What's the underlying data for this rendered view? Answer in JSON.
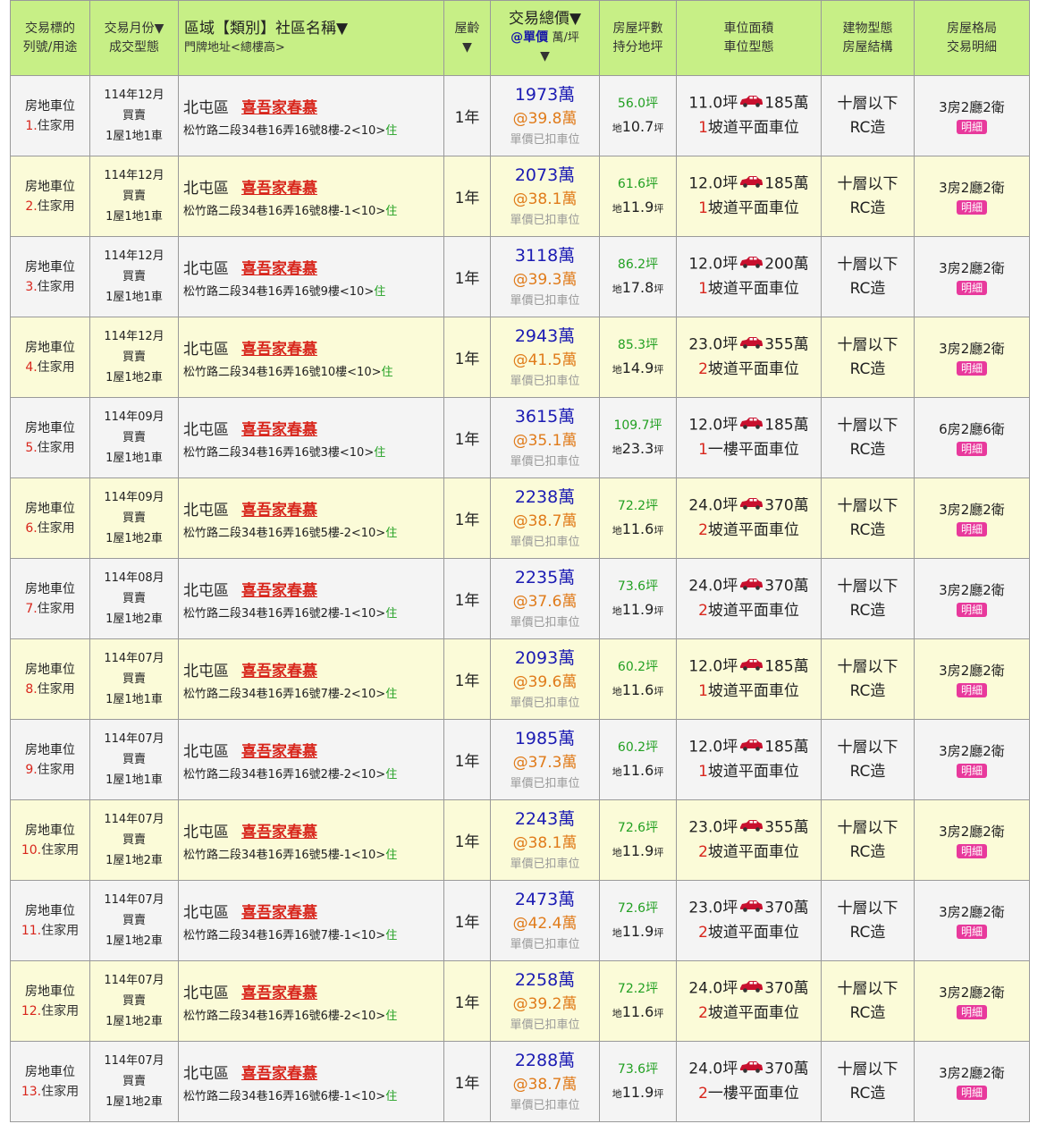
{
  "header": {
    "col1": [
      "交易標的",
      "列號/用途"
    ],
    "col2": [
      "交易月份▼",
      "成交型態"
    ],
    "col3_main": "區域【類別】社區名稱▼",
    "col3_sub": "門牌地址<總樓高>",
    "col4": [
      "屋齡",
      "▼"
    ],
    "col5_line1": "交易總價▼",
    "col5_unit_label": "@單價",
    "col5_unit_suffix": "萬/坪",
    "col5_arrow": "▼",
    "col6": [
      "房屋坪數",
      "持分地坪"
    ],
    "col7": [
      "車位面積",
      "車位型態"
    ],
    "col8": [
      "建物型態",
      "房屋結構"
    ],
    "col9": [
      "房屋格局",
      "交易明細"
    ]
  },
  "colors": {
    "header_bg": "#c7ef86",
    "row_odd": "#f4f4f4",
    "row_even": "#fbfbd8",
    "total_price": "#1b1bb3",
    "unit_price": "#e07b1a",
    "community": "#d8261c",
    "use_green": "#22a022",
    "detail_pink": "#e8399c"
  },
  "icons": {
    "car": "car-icon"
  },
  "rows": [
    {
      "type": "房地車位",
      "num": "1.",
      "use": "住家用",
      "month": "114年12月",
      "deal": "買賣",
      "units": "1屋1地1車",
      "district": "北屯區",
      "community": "喜吾家春慕",
      "address": "松竹路二段34巷16弄16號8樓-2<10>",
      "addr_use": "住",
      "age": "1年",
      "total": "1973萬",
      "unit": "@39.8萬",
      "note": "單價已扣車位",
      "area": "56.0坪",
      "land_prefix": "地",
      "land": "10.7",
      "land_suffix": "坪",
      "park_area": "11.0坪",
      "park_price": "185萬",
      "park_count": "1",
      "park_type": "坡道平面車位",
      "bld": "十層以下",
      "struct": "RC造",
      "layout": "3房2廳2衛",
      "detail": "明細"
    },
    {
      "type": "房地車位",
      "num": "2.",
      "use": "住家用",
      "month": "114年12月",
      "deal": "買賣",
      "units": "1屋1地1車",
      "district": "北屯區",
      "community": "喜吾家春慕",
      "address": "松竹路二段34巷16弄16號8樓-1<10>",
      "addr_use": "住",
      "age": "1年",
      "total": "2073萬",
      "unit": "@38.1萬",
      "note": "單價已扣車位",
      "area": "61.6坪",
      "land_prefix": "地",
      "land": "11.9",
      "land_suffix": "坪",
      "park_area": "12.0坪",
      "park_price": "185萬",
      "park_count": "1",
      "park_type": "坡道平面車位",
      "bld": "十層以下",
      "struct": "RC造",
      "layout": "3房2廳2衛",
      "detail": "明細"
    },
    {
      "type": "房地車位",
      "num": "3.",
      "use": "住家用",
      "month": "114年12月",
      "deal": "買賣",
      "units": "1屋1地1車",
      "district": "北屯區",
      "community": "喜吾家春慕",
      "address": "松竹路二段34巷16弄16號9樓<10>",
      "addr_use": "住",
      "age": "1年",
      "total": "3118萬",
      "unit": "@39.3萬",
      "note": "單價已扣車位",
      "area": "86.2坪",
      "land_prefix": "地",
      "land": "17.8",
      "land_suffix": "坪",
      "park_area": "12.0坪",
      "park_price": "200萬",
      "park_count": "1",
      "park_type": "坡道平面車位",
      "bld": "十層以下",
      "struct": "RC造",
      "layout": "3房2廳2衛",
      "detail": "明細"
    },
    {
      "type": "房地車位",
      "num": "4.",
      "use": "住家用",
      "month": "114年12月",
      "deal": "買賣",
      "units": "1屋1地2車",
      "district": "北屯區",
      "community": "喜吾家春慕",
      "address": "松竹路二段34巷16弄16號10樓<10>",
      "addr_use": "住",
      "age": "1年",
      "total": "2943萬",
      "unit": "@41.5萬",
      "note": "單價已扣車位",
      "area": "85.3坪",
      "land_prefix": "地",
      "land": "14.9",
      "land_suffix": "坪",
      "park_area": "23.0坪",
      "park_price": "355萬",
      "park_count": "2",
      "park_type": "坡道平面車位",
      "bld": "十層以下",
      "struct": "RC造",
      "layout": "3房2廳2衛",
      "detail": "明細"
    },
    {
      "type": "房地車位",
      "num": "5.",
      "use": "住家用",
      "month": "114年09月",
      "deal": "買賣",
      "units": "1屋1地1車",
      "district": "北屯區",
      "community": "喜吾家春慕",
      "address": "松竹路二段34巷16弄16號3樓<10>",
      "addr_use": "住",
      "age": "1年",
      "total": "3615萬",
      "unit": "@35.1萬",
      "note": "單價已扣車位",
      "area": "109.7坪",
      "land_prefix": "地",
      "land": "23.3",
      "land_suffix": "坪",
      "park_area": "12.0坪",
      "park_price": "185萬",
      "park_count": "1",
      "park_type": "一樓平面車位",
      "bld": "十層以下",
      "struct": "RC造",
      "layout": "6房2廳6衛",
      "detail": "明細"
    },
    {
      "type": "房地車位",
      "num": "6.",
      "use": "住家用",
      "month": "114年09月",
      "deal": "買賣",
      "units": "1屋1地2車",
      "district": "北屯區",
      "community": "喜吾家春慕",
      "address": "松竹路二段34巷16弄16號5樓-2<10>",
      "addr_use": "住",
      "age": "1年",
      "total": "2238萬",
      "unit": "@38.7萬",
      "note": "單價已扣車位",
      "area": "72.2坪",
      "land_prefix": "地",
      "land": "11.6",
      "land_suffix": "坪",
      "park_area": "24.0坪",
      "park_price": "370萬",
      "park_count": "2",
      "park_type": "坡道平面車位",
      "bld": "十層以下",
      "struct": "RC造",
      "layout": "3房2廳2衛",
      "detail": "明細"
    },
    {
      "type": "房地車位",
      "num": "7.",
      "use": "住家用",
      "month": "114年08月",
      "deal": "買賣",
      "units": "1屋1地2車",
      "district": "北屯區",
      "community": "喜吾家春慕",
      "address": "松竹路二段34巷16弄16號2樓-1<10>",
      "addr_use": "住",
      "age": "1年",
      "total": "2235萬",
      "unit": "@37.6萬",
      "note": "單價已扣車位",
      "area": "73.6坪",
      "land_prefix": "地",
      "land": "11.9",
      "land_suffix": "坪",
      "park_area": "24.0坪",
      "park_price": "370萬",
      "park_count": "2",
      "park_type": "坡道平面車位",
      "bld": "十層以下",
      "struct": "RC造",
      "layout": "3房2廳2衛",
      "detail": "明細"
    },
    {
      "type": "房地車位",
      "num": "8.",
      "use": "住家用",
      "month": "114年07月",
      "deal": "買賣",
      "units": "1屋1地1車",
      "district": "北屯區",
      "community": "喜吾家春慕",
      "address": "松竹路二段34巷16弄16號7樓-2<10>",
      "addr_use": "住",
      "age": "1年",
      "total": "2093萬",
      "unit": "@39.6萬",
      "note": "單價已扣車位",
      "area": "60.2坪",
      "land_prefix": "地",
      "land": "11.6",
      "land_suffix": "坪",
      "park_area": "12.0坪",
      "park_price": "185萬",
      "park_count": "1",
      "park_type": "坡道平面車位",
      "bld": "十層以下",
      "struct": "RC造",
      "layout": "3房2廳2衛",
      "detail": "明細"
    },
    {
      "type": "房地車位",
      "num": "9.",
      "use": "住家用",
      "month": "114年07月",
      "deal": "買賣",
      "units": "1屋1地1車",
      "district": "北屯區",
      "community": "喜吾家春慕",
      "address": "松竹路二段34巷16弄16號2樓-2<10>",
      "addr_use": "住",
      "age": "1年",
      "total": "1985萬",
      "unit": "@37.3萬",
      "note": "單價已扣車位",
      "area": "60.2坪",
      "land_prefix": "地",
      "land": "11.6",
      "land_suffix": "坪",
      "park_area": "12.0坪",
      "park_price": "185萬",
      "park_count": "1",
      "park_type": "坡道平面車位",
      "bld": "十層以下",
      "struct": "RC造",
      "layout": "3房2廳2衛",
      "detail": "明細"
    },
    {
      "type": "房地車位",
      "num": "10.",
      "use": "住家用",
      "month": "114年07月",
      "deal": "買賣",
      "units": "1屋1地2車",
      "district": "北屯區",
      "community": "喜吾家春慕",
      "address": "松竹路二段34巷16弄16號5樓-1<10>",
      "addr_use": "住",
      "age": "1年",
      "total": "2243萬",
      "unit": "@38.1萬",
      "note": "單價已扣車位",
      "area": "72.6坪",
      "land_prefix": "地",
      "land": "11.9",
      "land_suffix": "坪",
      "park_area": "23.0坪",
      "park_price": "355萬",
      "park_count": "2",
      "park_type": "坡道平面車位",
      "bld": "十層以下",
      "struct": "RC造",
      "layout": "3房2廳2衛",
      "detail": "明細"
    },
    {
      "type": "房地車位",
      "num": "11.",
      "use": "住家用",
      "month": "114年07月",
      "deal": "買賣",
      "units": "1屋1地2車",
      "district": "北屯區",
      "community": "喜吾家春慕",
      "address": "松竹路二段34巷16弄16號7樓-1<10>",
      "addr_use": "住",
      "age": "1年",
      "total": "2473萬",
      "unit": "@42.4萬",
      "note": "單價已扣車位",
      "area": "72.6坪",
      "land_prefix": "地",
      "land": "11.9",
      "land_suffix": "坪",
      "park_area": "23.0坪",
      "park_price": "370萬",
      "park_count": "2",
      "park_type": "坡道平面車位",
      "bld": "十層以下",
      "struct": "RC造",
      "layout": "3房2廳2衛",
      "detail": "明細"
    },
    {
      "type": "房地車位",
      "num": "12.",
      "use": "住家用",
      "month": "114年07月",
      "deal": "買賣",
      "units": "1屋1地2車",
      "district": "北屯區",
      "community": "喜吾家春慕",
      "address": "松竹路二段34巷16弄16號6樓-2<10>",
      "addr_use": "住",
      "age": "1年",
      "total": "2258萬",
      "unit": "@39.2萬",
      "note": "單價已扣車位",
      "area": "72.2坪",
      "land_prefix": "地",
      "land": "11.6",
      "land_suffix": "坪",
      "park_area": "24.0坪",
      "park_price": "370萬",
      "park_count": "2",
      "park_type": "坡道平面車位",
      "bld": "十層以下",
      "struct": "RC造",
      "layout": "3房2廳2衛",
      "detail": "明細"
    },
    {
      "type": "房地車位",
      "num": "13.",
      "use": "住家用",
      "month": "114年07月",
      "deal": "買賣",
      "units": "1屋1地2車",
      "district": "北屯區",
      "community": "喜吾家春慕",
      "address": "松竹路二段34巷16弄16號6樓-1<10>",
      "addr_use": "住",
      "age": "1年",
      "total": "2288萬",
      "unit": "@38.7萬",
      "note": "單價已扣車位",
      "area": "73.6坪",
      "land_prefix": "地",
      "land": "11.9",
      "land_suffix": "坪",
      "park_area": "24.0坪",
      "park_price": "370萬",
      "park_count": "2",
      "park_type": "一樓平面車位",
      "bld": "十層以下",
      "struct": "RC造",
      "layout": "3房2廳2衛",
      "detail": "明細"
    }
  ]
}
